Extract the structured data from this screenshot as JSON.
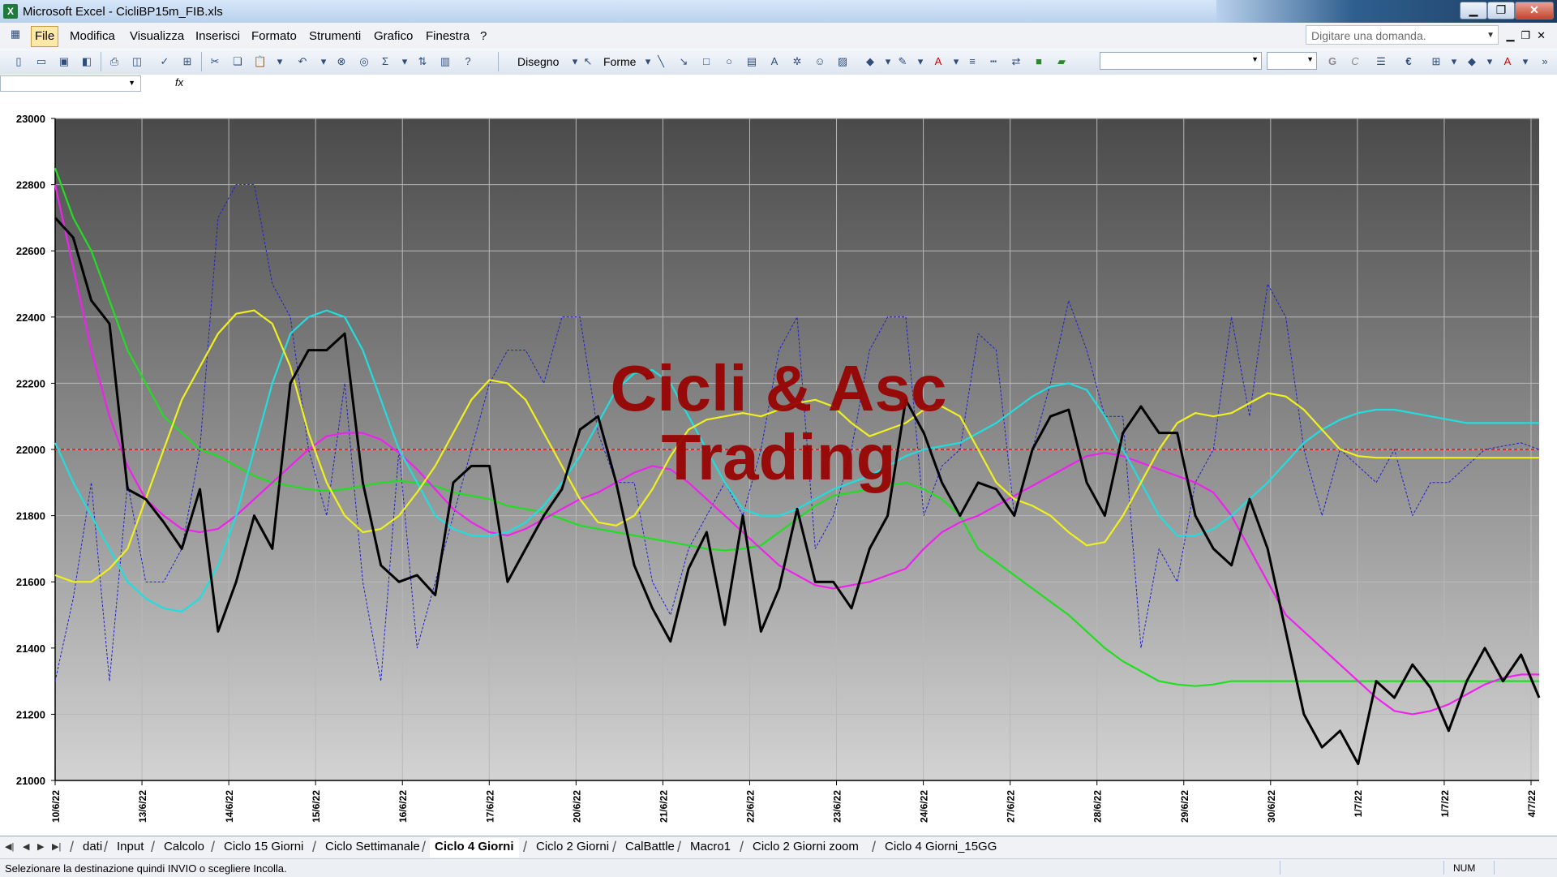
{
  "window": {
    "title": "Microsoft Excel - CicliBP15m_FIB.xls",
    "app_icon": "excel-icon"
  },
  "menu": {
    "items": [
      "File",
      "Modifica",
      "Visualizza",
      "Inserisci",
      "Formato",
      "Strumenti",
      "Grafico",
      "Finestra",
      "?"
    ],
    "active": "File",
    "ask_placeholder": "Digitare una domanda."
  },
  "toolbar": {
    "draw_label": "Disegno",
    "shapes_label": "Forme",
    "bold_label": "G",
    "italic_label": "C",
    "euro_label": "€",
    "sigma_label": "Σ"
  },
  "formula_bar": {
    "fx_label": "fx",
    "name_box": ""
  },
  "chart_data": {
    "type": "line",
    "watermark": [
      "Cicli & Asc",
      "Trading"
    ],
    "ylim": [
      21000,
      23000
    ],
    "y_ticks": [
      21000,
      21200,
      21400,
      21600,
      21800,
      22000,
      22200,
      22400,
      22600,
      22800,
      23000
    ],
    "x_tick_labels": [
      "10/6/22",
      "13/6/22",
      "14/6/22",
      "15/6/22",
      "16/6/22",
      "17/6/22",
      "20/6/22",
      "21/6/22",
      "22/6/22",
      "23/6/22",
      "24/6/22",
      "27/6/22",
      "28/6/22",
      "29/6/22",
      "30/6/22",
      "1/7/22",
      "1/7/22",
      "4/7/22"
    ],
    "reference_line": 22000,
    "grid": true,
    "colors": {
      "price": "#000000",
      "oscillator": "#2020cc",
      "green": "#22dd22",
      "magenta": "#ee22ee",
      "cyan": "#22dddd",
      "yellow": "#f0f020",
      "reference": "#dd2222",
      "watermark": "#990000"
    },
    "series": [
      {
        "key": "price",
        "values": [
          22700,
          22640,
          22450,
          22380,
          21880,
          21850,
          21780,
          21700,
          21880,
          21450,
          21600,
          21800,
          21700,
          22200,
          22300,
          22300,
          22350,
          21900,
          21650,
          21600,
          21620,
          21560,
          21900,
          21950,
          21950,
          21600,
          21700,
          21800,
          21880,
          22060,
          22100,
          21900,
          21650,
          21520,
          21420,
          21640,
          21750,
          21470,
          21800,
          21450,
          21580,
          21820,
          21600,
          21600,
          21520,
          21700,
          21800,
          22150,
          22050,
          21900,
          21800,
          21900,
          21880,
          21800,
          22000,
          22100,
          22120,
          21900,
          21800,
          22050,
          22130,
          22050,
          22050,
          21800,
          21700,
          21650,
          21850,
          21700,
          21450,
          21200,
          21100,
          21150,
          21050,
          21300,
          21250,
          21350,
          21280,
          21150,
          21300,
          21400,
          21300,
          21380,
          21250
        ]
      },
      {
        "key": "oscillator",
        "values": [
          21300,
          21550,
          21900,
          21300,
          21900,
          21600,
          21600,
          21700,
          22000,
          22700,
          22800,
          22800,
          22500,
          22400,
          22000,
          21800,
          22200,
          21600,
          21300,
          22000,
          21400,
          21600,
          21800,
          22000,
          22200,
          22300,
          22300,
          22200,
          22400,
          22400,
          22050,
          21900,
          21900,
          21600,
          21500,
          21700,
          21800,
          21900,
          21800,
          22000,
          22300,
          22400,
          21700,
          21800,
          22000,
          22300,
          22400,
          22400,
          21800,
          21950,
          22000,
          22350,
          22300,
          21800,
          22000,
          22200,
          22450,
          22300,
          22100,
          22100,
          21400,
          21700,
          21600,
          21900,
          22000,
          22400,
          22100,
          22500,
          22400,
          22000,
          21800,
          22000,
          21950,
          21900,
          22000,
          21800,
          21900,
          21900,
          21950,
          22000,
          22010,
          22020,
          22000
        ]
      },
      {
        "key": "green",
        "values": [
          22850,
          22700,
          22600,
          22450,
          22300,
          22200,
          22100,
          22050,
          22000,
          21980,
          21950,
          21920,
          21900,
          21890,
          21880,
          21875,
          21880,
          21890,
          21900,
          21905,
          21900,
          21890,
          21870,
          21860,
          21850,
          21830,
          21820,
          21810,
          21790,
          21770,
          21760,
          21750,
          21740,
          21730,
          21720,
          21710,
          21700,
          21695,
          21700,
          21710,
          21750,
          21790,
          21830,
          21860,
          21870,
          21880,
          21890,
          21900,
          21880,
          21850,
          21800,
          21700,
          21660,
          21620,
          21580,
          21540,
          21500,
          21450,
          21400,
          21360,
          21330,
          21300,
          21290,
          21285,
          21290,
          21300,
          21300,
          21300,
          21300,
          21300,
          21300,
          21300,
          21300,
          21300,
          21300,
          21300,
          21300,
          21300,
          21300,
          21300,
          21300,
          21300,
          21300
        ]
      },
      {
        "key": "magenta",
        "values": [
          22800,
          22550,
          22300,
          22100,
          21950,
          21850,
          21800,
          21760,
          21750,
          21760,
          21800,
          21850,
          21900,
          21950,
          22000,
          22040,
          22050,
          22050,
          22030,
          21990,
          21940,
          21880,
          21820,
          21780,
          21750,
          21740,
          21760,
          21790,
          21820,
          21850,
          21870,
          21900,
          21930,
          21950,
          21940,
          21900,
          21850,
          21800,
          21750,
          21700,
          21650,
          21620,
          21590,
          21580,
          21590,
          21600,
          21620,
          21640,
          21700,
          21750,
          21780,
          21800,
          21830,
          21860,
          21890,
          21920,
          21950,
          21980,
          21990,
          21980,
          21960,
          21940,
          21920,
          21900,
          21870,
          21800,
          21700,
          21600,
          21500,
          21450,
          21400,
          21350,
          21300,
          21250,
          21210,
          21200,
          21210,
          21230,
          21260,
          21290,
          21310,
          21320,
          21320
        ]
      },
      {
        "key": "cyan",
        "values": [
          22020,
          21900,
          21800,
          21700,
          21600,
          21550,
          21520,
          21510,
          21550,
          21650,
          21800,
          22000,
          22200,
          22350,
          22400,
          22420,
          22400,
          22300,
          22150,
          22000,
          21900,
          21800,
          21760,
          21740,
          21740,
          21750,
          21780,
          21830,
          21900,
          21980,
          22080,
          22180,
          22230,
          22240,
          22200,
          22100,
          22000,
          21900,
          21820,
          21800,
          21800,
          21820,
          21850,
          21880,
          21900,
          21920,
          21950,
          21980,
          22000,
          22010,
          22020,
          22050,
          22080,
          22120,
          22160,
          22190,
          22200,
          22180,
          22100,
          22000,
          21900,
          21800,
          21740,
          21740,
          21760,
          21800,
          21850,
          21900,
          21960,
          22020,
          22060,
          22090,
          22110,
          22120,
          22120,
          22110,
          22100,
          22090,
          22080,
          22080,
          22080,
          22080,
          22080
        ]
      },
      {
        "key": "yellow",
        "values": [
          21620,
          21600,
          21600,
          21640,
          21700,
          21850,
          22000,
          22150,
          22250,
          22350,
          22410,
          22420,
          22380,
          22250,
          22050,
          21900,
          21800,
          21750,
          21760,
          21800,
          21870,
          21950,
          22050,
          22150,
          22210,
          22200,
          22150,
          22050,
          21950,
          21850,
          21780,
          21770,
          21800,
          21880,
          21980,
          22060,
          22090,
          22100,
          22110,
          22100,
          22120,
          22140,
          22150,
          22130,
          22080,
          22040,
          22060,
          22080,
          22120,
          22130,
          22100,
          22000,
          21900,
          21850,
          21830,
          21800,
          21750,
          21710,
          21720,
          21800,
          21900,
          22000,
          22080,
          22110,
          22100,
          22110,
          22140,
          22170,
          22160,
          22120,
          22060,
          22000,
          21980,
          21975,
          21975,
          21975,
          21975,
          21975,
          21975,
          21975,
          21975,
          21975,
          21975
        ]
      }
    ]
  },
  "sheet_tabs": [
    "dati",
    "Input",
    "Calcolo",
    "Ciclo 15 Giorni",
    "Ciclo Settimanale",
    "Ciclo 4 Giorni",
    "Ciclo 2 Giorni",
    "CalBattle",
    "Macro1",
    "Ciclo 2 Giorni zoom",
    "Ciclo 4 Giorni_15GG"
  ],
  "active_tab": "Ciclo 4 Giorni",
  "status": {
    "message": "Selezionare la destinazione quindi INVIO o scegliere Incolla.",
    "num": "NUM"
  }
}
